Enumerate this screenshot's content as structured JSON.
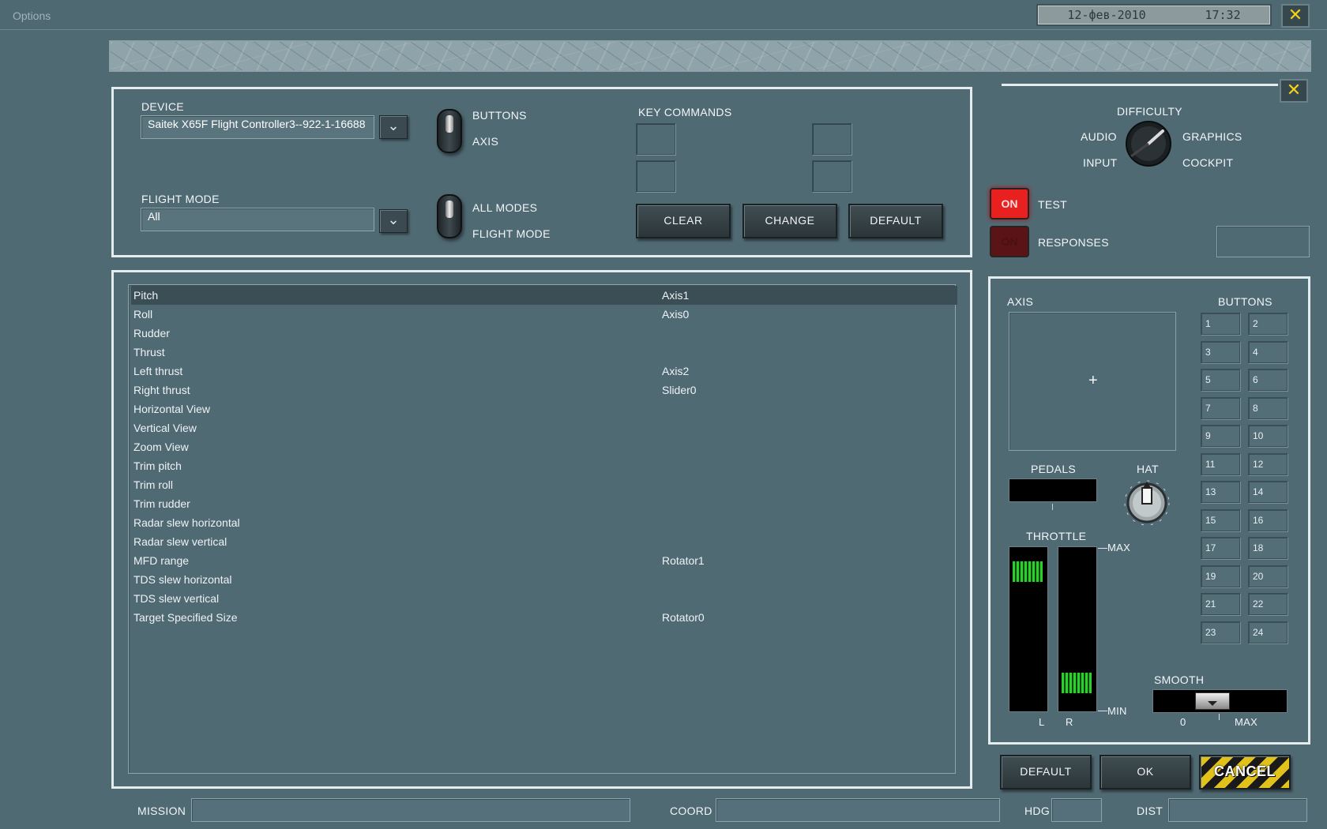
{
  "window": {
    "title": "Options",
    "datetime_date": "12-фев-2010",
    "datetime_time": "17:32"
  },
  "device_panel": {
    "device_label": "DEVICE",
    "device_value": "Saitek X65F Flight Controller3--922-1-16688",
    "flight_mode_label": "FLIGHT MODE",
    "flight_mode_value": "All",
    "toggle1_top": "BUTTONS",
    "toggle1_bottom": "AXIS",
    "toggle2_top": "ALL MODES",
    "toggle2_bottom": "FLIGHT MODE",
    "key_commands_label": "KEY COMMANDS",
    "clear": "CLEAR",
    "change": "CHANGE",
    "default": "DEFAULT"
  },
  "bindings": [
    {
      "action": "Pitch",
      "axis": "Axis1",
      "selected": true
    },
    {
      "action": "Roll",
      "axis": "Axis0"
    },
    {
      "action": "Rudder",
      "axis": ""
    },
    {
      "action": "Thrust",
      "axis": ""
    },
    {
      "action": "Left thrust",
      "axis": "Axis2"
    },
    {
      "action": "Right thrust",
      "axis": "Slider0"
    },
    {
      "action": "Horizontal View",
      "axis": ""
    },
    {
      "action": "Vertical View",
      "axis": ""
    },
    {
      "action": "Zoom View",
      "axis": ""
    },
    {
      "action": "Trim pitch",
      "axis": ""
    },
    {
      "action": "Trim roll",
      "axis": ""
    },
    {
      "action": "Trim rudder",
      "axis": ""
    },
    {
      "action": "Radar slew horizontal",
      "axis": ""
    },
    {
      "action": "Radar slew vertical",
      "axis": ""
    },
    {
      "action": "MFD range",
      "axis": "Rotator1"
    },
    {
      "action": "TDS slew horizontal",
      "axis": ""
    },
    {
      "action": "TDS slew vertical",
      "axis": ""
    },
    {
      "action": "Target Specified Size",
      "axis": "Rotator0"
    }
  ],
  "category_knob": {
    "difficulty": "DIFFICULTY",
    "audio": "AUDIO",
    "graphics": "GRAPHICS",
    "input": "INPUT",
    "cockpit": "COCKPIT"
  },
  "test": {
    "state": "ON",
    "label": "TEST"
  },
  "responses": {
    "state": "ON",
    "label": "RESPONSES"
  },
  "monitor": {
    "axis_label": "AXIS",
    "buttons_label": "BUTTONS",
    "buttons": [
      "1",
      "2",
      "3",
      "4",
      "5",
      "6",
      "7",
      "8",
      "9",
      "10",
      "11",
      "12",
      "13",
      "14",
      "15",
      "16",
      "17",
      "18",
      "19",
      "20",
      "21",
      "22",
      "23",
      "24"
    ],
    "pedals_label": "PEDALS",
    "hat_label": "HAT",
    "throttle_label": "THROTTLE",
    "max": "MAX",
    "min": "MIN",
    "l": "L",
    "r": "R",
    "smooth_label": "SMOOTH",
    "smooth_min": "0",
    "smooth_max": "MAX",
    "throttle_left_level": 0.92,
    "throttle_right_level": 0.12
  },
  "footer_buttons": {
    "default": "DEFAULT",
    "ok": "OK",
    "cancel": "CANCEL"
  },
  "statusbar": {
    "mission": "MISSION",
    "coord": "COORD",
    "hdg": "HDG",
    "dist": "DIST"
  },
  "colors": {
    "on_active": "#e8201f",
    "on_inactive": "#5a1416",
    "cancel_stripe": "#e1c21a",
    "meter_green": "#2bd12b"
  }
}
